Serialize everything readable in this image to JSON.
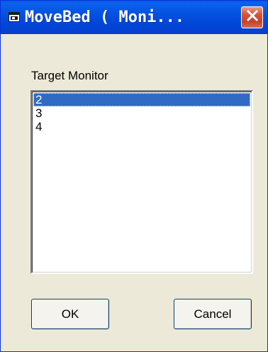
{
  "window": {
    "title": "MoveBed ( Moni...",
    "title_icon": "application-icon",
    "close_icon": "close-icon"
  },
  "target": {
    "label": "Target Monitor",
    "items": [
      "2",
      "3",
      "4"
    ],
    "selected": "2"
  },
  "buttons": {
    "ok_label": "OK",
    "cancel_label": "Cancel"
  },
  "colors": {
    "titlebar": "#0054e3",
    "selection": "#316ac5",
    "close_button": "#d8543a",
    "dialog_background": "#ece9d8"
  }
}
